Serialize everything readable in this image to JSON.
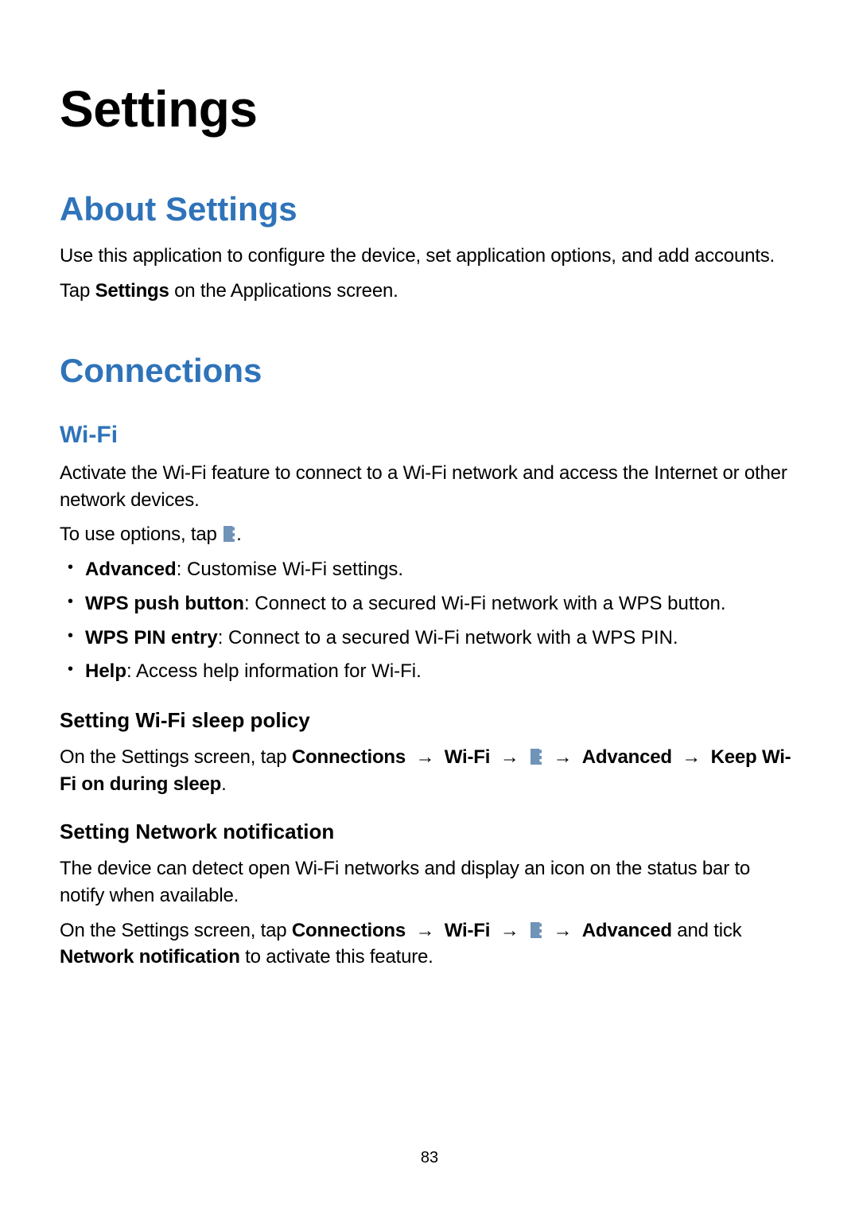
{
  "page_title": "Settings",
  "about": {
    "heading": "About Settings",
    "intro": "Use this application to configure the device, set application options, and add accounts.",
    "tap_prefix": "Tap ",
    "tap_bold": "Settings",
    "tap_suffix": " on the Applications screen."
  },
  "connections": {
    "heading": "Connections",
    "wifi": {
      "heading": "Wi-Fi",
      "intro": "Activate the Wi-Fi feature to connect to a Wi-Fi network and access the Internet or other network devices.",
      "options_prefix": "To use options, tap ",
      "options_suffix": ".",
      "options": [
        {
          "term": "Advanced",
          "desc": ": Customise Wi-Fi settings."
        },
        {
          "term": "WPS push button",
          "desc": ": Connect to a secured Wi-Fi network with a WPS button."
        },
        {
          "term": "WPS PIN entry",
          "desc": ": Connect to a secured Wi-Fi network with a WPS PIN."
        },
        {
          "term": "Help",
          "desc": ": Access help information for Wi-Fi."
        }
      ],
      "sleep": {
        "heading": "Setting Wi-Fi sleep policy",
        "prefix": "On the Settings screen, tap ",
        "path1": "Connections",
        "arrow": " → ",
        "path2": "Wi-Fi",
        "path3": "Advanced",
        "path4": "Keep Wi-Fi on during sleep",
        "suffix": "."
      },
      "network_notification": {
        "heading": "Setting Network notification",
        "desc": "The device can detect open Wi-Fi networks and display an icon on the status bar to notify when available.",
        "prefix": "On the Settings screen, tap ",
        "path1": "Connections",
        "arrow": " → ",
        "path2": "Wi-Fi",
        "path3": "Advanced",
        "and_tick": " and tick ",
        "path4": "Network notification",
        "suffix": " to activate this feature."
      }
    }
  },
  "page_number": "83"
}
